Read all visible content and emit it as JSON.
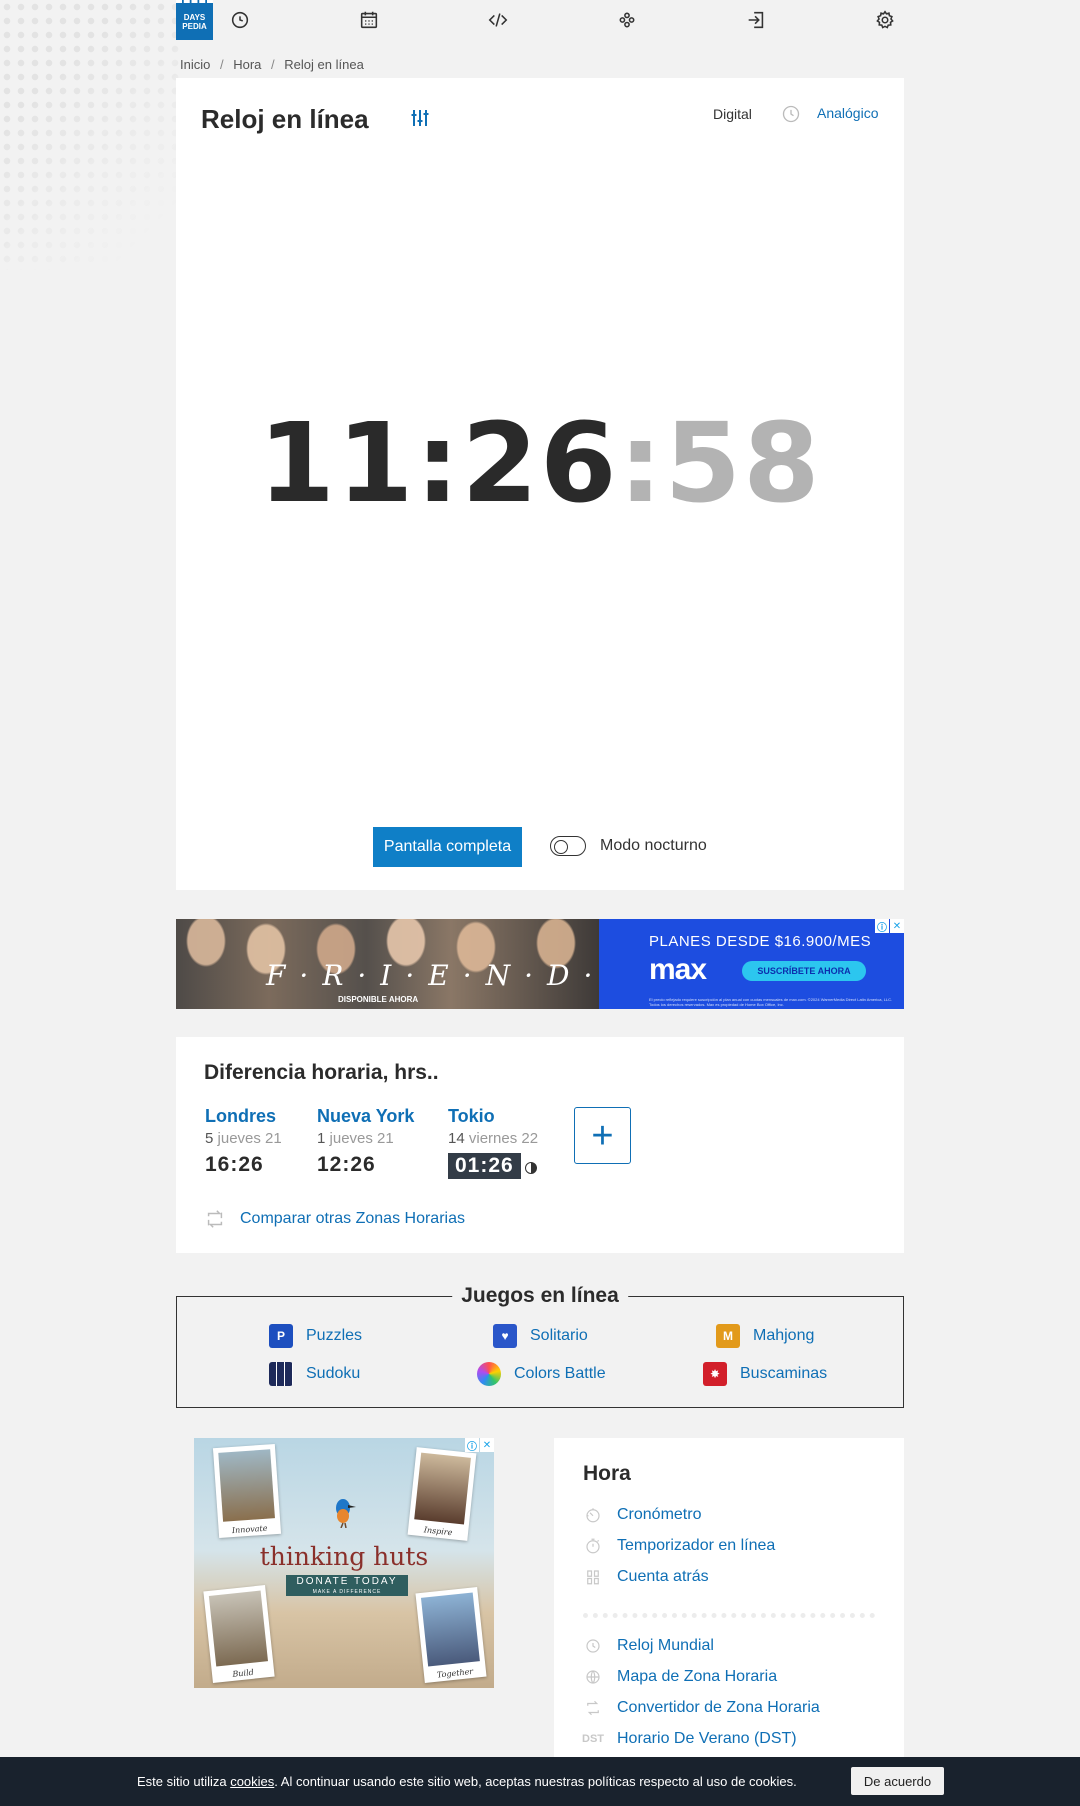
{
  "brand": {
    "logo_line1": "DAYS",
    "logo_line2": "PEDIA"
  },
  "nav": {
    "icons": [
      "clock-icon",
      "calendar-icon",
      "code-icon",
      "games-icon",
      "login-icon",
      "gear-icon"
    ]
  },
  "breadcrumb": [
    "Inicio",
    "Hora",
    "Reloj en línea"
  ],
  "clock": {
    "title": "Reloj en línea",
    "mode_digital": "Digital",
    "mode_analog": "Analógico",
    "hours_minutes": "11:26",
    "seconds_sep": ":",
    "seconds": "58",
    "fullscreen_label": "Pantalla completa",
    "night_mode_label": "Modo nocturno",
    "night_mode_on": false
  },
  "ad_top": {
    "show_name": "F·R·I·E·N·D·S",
    "available": "DISPONIBLE AHORA",
    "plans": "PLANES DESDE $16.900/MES",
    "brand": "max",
    "cta": "SUSCRÍBETE AHORA",
    "fine_print": "El precio reflejado requiere suscripción al plan anual con cuotas mensuales de max.com. ©2024 WarnerMedia Direct Latin America, LLC. Todos los derechos reservados. Max es propiedad de Home Box Office, Inc."
  },
  "time_diff": {
    "title": "Diferencia horaria, hrs..",
    "cities": [
      {
        "name": "Londres",
        "diff": "5",
        "day": "jueves 21",
        "time": "16:26",
        "night": false
      },
      {
        "name": "Nueva York",
        "diff": "1",
        "day": "jueves 21",
        "time": "12:26",
        "night": false
      },
      {
        "name": "Tokio",
        "diff": "14",
        "day": "viernes 22",
        "time": "01:26",
        "night": true
      }
    ],
    "add_label": "+",
    "compare_label": "Comparar otras Zonas Horarias"
  },
  "games": {
    "title": "Juegos en línea",
    "items": [
      "Puzzles",
      "Solitario",
      "Mahjong",
      "Sudoku",
      "Colors Battle",
      "Buscaminas"
    ]
  },
  "ad_bottom": {
    "title": "thinking huts",
    "cta": "DONATE TODAY",
    "cta_sub": "MAKE A DIFFERENCE",
    "captions": [
      "Innovate",
      "Inspire",
      "Build",
      "Together"
    ]
  },
  "hora": {
    "title": "Hora",
    "group1": [
      "Cronómetro",
      "Temporizador en línea",
      "Cuenta atrás"
    ],
    "group2": [
      "Reloj Mundial",
      "Mapa de Zona Horaria",
      "Convertidor de Zona Horaria",
      "Horario De Verano (DST)"
    ],
    "dst_badge": "DST"
  },
  "cookie": {
    "text_before": "Este sitio utiliza ",
    "link": "cookies",
    "text_after": ". Al continuar usando este sitio web, aceptas nuestras políticas respecto al uso de cookies.",
    "accept": "De acuerdo"
  },
  "colors": {
    "accent": "#0f6fb5",
    "button": "#0f7fc7",
    "cookie_bg": "#19222d"
  }
}
